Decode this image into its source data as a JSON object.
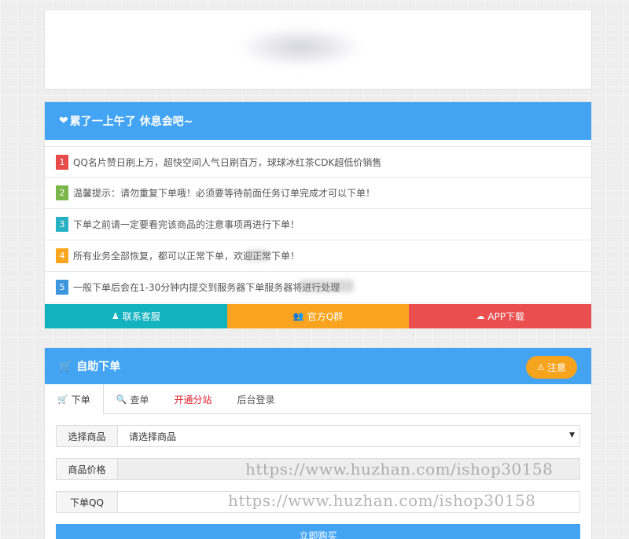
{
  "notice": {
    "heading": "累了一上午了 休息会吧~",
    "items": [
      {
        "num": "1",
        "text": "QQ名片赞日刷上万，超快空间人气日刷百万，球球冰红茶CDK超低价销售"
      },
      {
        "num": "2",
        "text": "温馨提示：请勿重复下单哦！必须要等待前面任务订单完成才可以下单！"
      },
      {
        "num": "3",
        "text": "下单之前请一定要看完该商品的注意事项再进行下单！"
      },
      {
        "num": "4",
        "text": "所有业务全部恢复，都可以正常下单，欢迎正常下单！"
      },
      {
        "num": "5",
        "text": "一般下单后会在1-30分钟内提交到服务器下单服务器将进行处理"
      }
    ],
    "buttons": {
      "contact": "联系客服",
      "group": "官方Q群",
      "app": "APP下载"
    }
  },
  "order": {
    "heading": "自助下单",
    "notice_btn": "注意",
    "tabs": {
      "order": "下单",
      "query": "查单",
      "branch": "开通分站",
      "admin": "后台登录"
    },
    "fields": {
      "product_label": "选择商品",
      "product_value": "请选择商品",
      "price_label": "商品价格",
      "qq_label": "下单QQ"
    },
    "buy": "立即购买"
  },
  "watermark": {
    "line1": "https://www.huzhan.com/ishop30158",
    "line2": "https://www.huzhan.com/ishop30158"
  },
  "colors": {
    "panel_header": "#43a4f3",
    "contact": "#13b2bf",
    "group": "#f9a41f",
    "app": "#ea4e4e",
    "notice_btn": "#f6a31e",
    "branch_tab": "#e0202a"
  }
}
